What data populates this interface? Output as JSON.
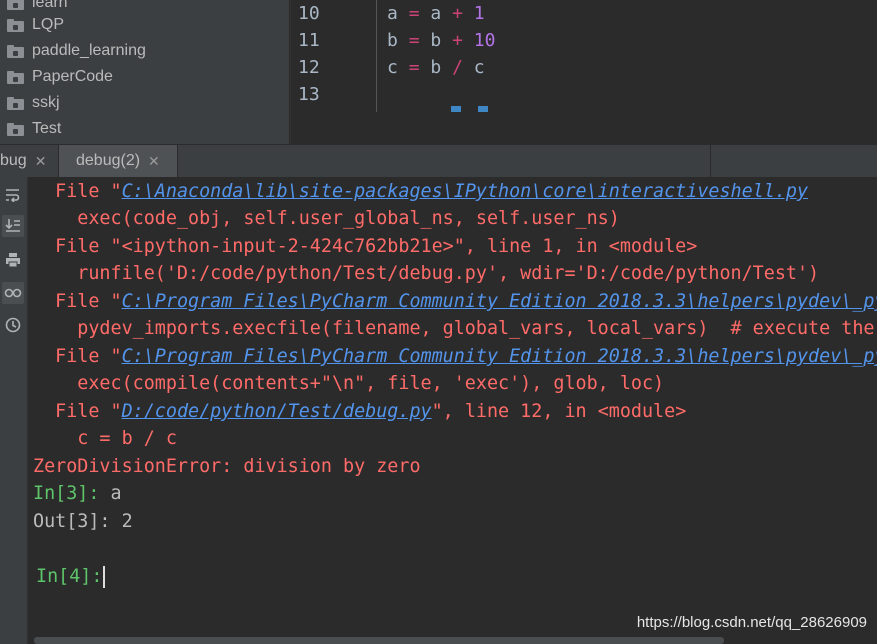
{
  "project_tree": {
    "items": [
      {
        "label": "learn"
      },
      {
        "label": "LQP"
      },
      {
        "label": "paddle_learning"
      },
      {
        "label": "PaperCode"
      },
      {
        "label": "sskj"
      },
      {
        "label": "Test"
      }
    ]
  },
  "editor": {
    "lines": [
      {
        "number": "10",
        "lhs": "a",
        "op1": "=",
        "rhs1": "a",
        "op2": "+",
        "rhs2": "1"
      },
      {
        "number": "11",
        "lhs": "b",
        "op1": "=",
        "rhs1": "b",
        "op2": "+",
        "rhs2": "10"
      },
      {
        "number": "12",
        "lhs": "c",
        "op1": "=",
        "rhs1": "b",
        "op2": "/",
        "rhs2": "c"
      },
      {
        "number": "13"
      }
    ]
  },
  "tabs": [
    {
      "label": "bug"
    },
    {
      "label": "debug(2)"
    }
  ],
  "toolbar_icons": [
    "soft-wrap-icon",
    "scroll-to-end-icon",
    "print-icon",
    "show-variables-icon",
    "history-icon"
  ],
  "console": {
    "lines": [
      {
        "prefix": "  File \"",
        "link": "C:\\Anaconda\\lib\\site-packages\\IPython\\core\\interactiveshell.py",
        "suffix": ""
      },
      {
        "text": "    exec(code_obj, self.user_global_ns, self.user_ns)"
      },
      {
        "text": "  File \"<ipython-input-2-424c762bb21e>\", line 1, in <module>"
      },
      {
        "text": "    runfile('D:/code/python/Test/debug.py', wdir='D:/code/python/Test')"
      },
      {
        "prefix": "  File \"",
        "link": "C:\\Program Files\\PyCharm Community Edition 2018.3.3\\helpers\\pydev\\_pydev_bundle\\pydev_umd.py",
        "suffix": ""
      },
      {
        "text": "    pydev_imports.execfile(filename, global_vars, local_vars)  # execute the script"
      },
      {
        "prefix": "  File \"",
        "link": "C:\\Program Files\\PyCharm Community Edition 2018.3.3\\helpers\\pydev\\_pydev_imps\\_pydev_execfile.py",
        "suffix": ""
      },
      {
        "text": "    exec(compile(contents+\"\\n\", file, 'exec'), glob, loc)"
      },
      {
        "prefix": "  File \"",
        "link": "D:/code/python/Test/debug.py",
        "suffix": "\", line 12, in <module>"
      },
      {
        "text": "    c = b / c"
      },
      {
        "text": "ZeroDivisionError: division by zero"
      }
    ],
    "in3_prompt": "In[3]:",
    "in3_value": " a",
    "out3_label": "Out[3]:",
    "out3_value": " 2",
    "in4_prompt": "In[4]:"
  },
  "watermark": "https://blog.csdn.net/qq_28626909",
  "colors": {
    "error": "#ff6b68",
    "link": "#5394ec",
    "prompt": "#5ec46a",
    "operator": "#cc4477",
    "number": "#b273e6"
  }
}
